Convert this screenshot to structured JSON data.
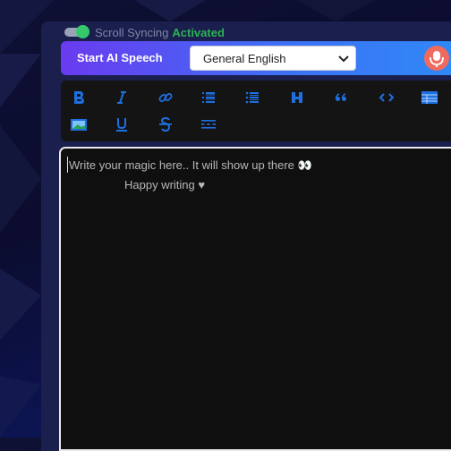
{
  "scroll_sync": {
    "label": "Scroll Syncing",
    "state": "Activated",
    "enabled": true
  },
  "speech": {
    "button_label": "Start AI Speech",
    "language": "General English"
  },
  "toolbar": {
    "buttons": [
      {
        "name": "bold-icon"
      },
      {
        "name": "italic-icon"
      },
      {
        "name": "link-icon"
      },
      {
        "name": "ordered-list-icon"
      },
      {
        "name": "unordered-list-icon"
      },
      {
        "name": "heading-icon"
      },
      {
        "name": "quote-icon"
      },
      {
        "name": "code-icon"
      },
      {
        "name": "table-icon"
      },
      {
        "name": "image-icon"
      },
      {
        "name": "underline-icon"
      },
      {
        "name": "strikethrough-icon"
      },
      {
        "name": "horizontal-rule-icon"
      }
    ]
  },
  "editor": {
    "placeholder_line1": "Write your magic here.. It will show up there 👀",
    "placeholder_line2": "Happy writing ♥"
  },
  "colors": {
    "accent_blue": "#1e6fe0",
    "toggle_on": "#35c96b",
    "activated_text": "#2bb352",
    "mic": "#f06a5e"
  }
}
